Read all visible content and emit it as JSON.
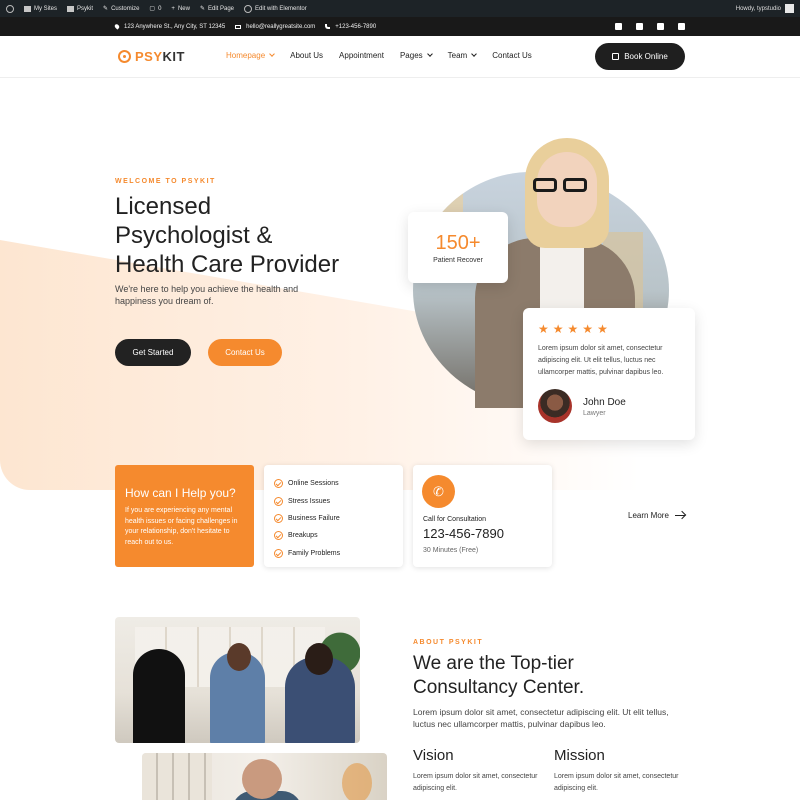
{
  "admin_bar": {
    "items": [
      "My Sites",
      "Psykit",
      "Customize",
      "0",
      "New",
      "Edit Page",
      "Edit with Elementor"
    ],
    "greeting": "Howdy, typstudio"
  },
  "topbar": {
    "address": "123 Anywhere St., Any City, ST 12345",
    "email": "hello@reallygreatsite.com",
    "phone": "+123-456-7890",
    "social_icons": [
      "facebook-icon",
      "instagram-icon",
      "twitter-icon",
      "youtube-icon"
    ]
  },
  "header": {
    "logo_psy": "PSY",
    "logo_kit": "KIT",
    "nav": [
      {
        "label": "Homepage",
        "active": true,
        "dropdown": true
      },
      {
        "label": "About Us",
        "active": false,
        "dropdown": false
      },
      {
        "label": "Appointment",
        "active": false,
        "dropdown": false
      },
      {
        "label": "Pages",
        "active": false,
        "dropdown": true
      },
      {
        "label": "Team",
        "active": false,
        "dropdown": true
      },
      {
        "label": "Contact Us",
        "active": false,
        "dropdown": false
      }
    ],
    "book_label": "Book Online"
  },
  "hero": {
    "kicker": "WELCOME TO PSYKIT",
    "title_lines": [
      "Licensed",
      "Psychologist &",
      "Health Care Provider"
    ],
    "subtitle": "We're here to help you achieve the health and happiness you dream of.",
    "btn_primary": "Get Started",
    "btn_secondary": "Contact Us",
    "stat_value": "150+",
    "stat_label": "Patient Recover",
    "review": {
      "stars": 5,
      "text": "Lorem ipsum dolor sit amet, consectetur adipiscing elit. Ut elit tellus, luctus nec ullamcorper mattis, pulvinar dapibus leo.",
      "name": "John Doe",
      "role": "Lawyer"
    }
  },
  "services": {
    "help_title": "How can I Help you?",
    "help_text": "If you are experiencing any mental health issues or facing challenges in your relationship, don't hesitate to reach out to us.",
    "list": [
      "Online Sessions",
      "Stress Issues",
      "Business Failure",
      "Breakups",
      "Family Problems"
    ],
    "call_label": "Call for Consultation",
    "call_number": "123-456-7890",
    "call_note": "30 Minutes (Free)",
    "learn_more": "Learn More"
  },
  "about": {
    "kicker": "ABOUT PSYKIT",
    "title_lines": [
      "We are the Top-tier",
      "Consultancy Center."
    ],
    "text": "Lorem ipsum dolor sit amet, consectetur adipiscing elit. Ut elit tellus, luctus nec ullamcorper mattis, pulvinar dapibus leo.",
    "vision_title": "Vision",
    "vision_text": "Lorem ipsum dolor sit amet, consectetur adipiscing elit.",
    "mission_title": "Mission",
    "mission_text": "Lorem ipsum dolor sit amet, consectetur adipiscing elit."
  },
  "colors": {
    "accent": "#f58a2e",
    "dark": "#1f1f1f",
    "adminbar": "#1d2327"
  }
}
